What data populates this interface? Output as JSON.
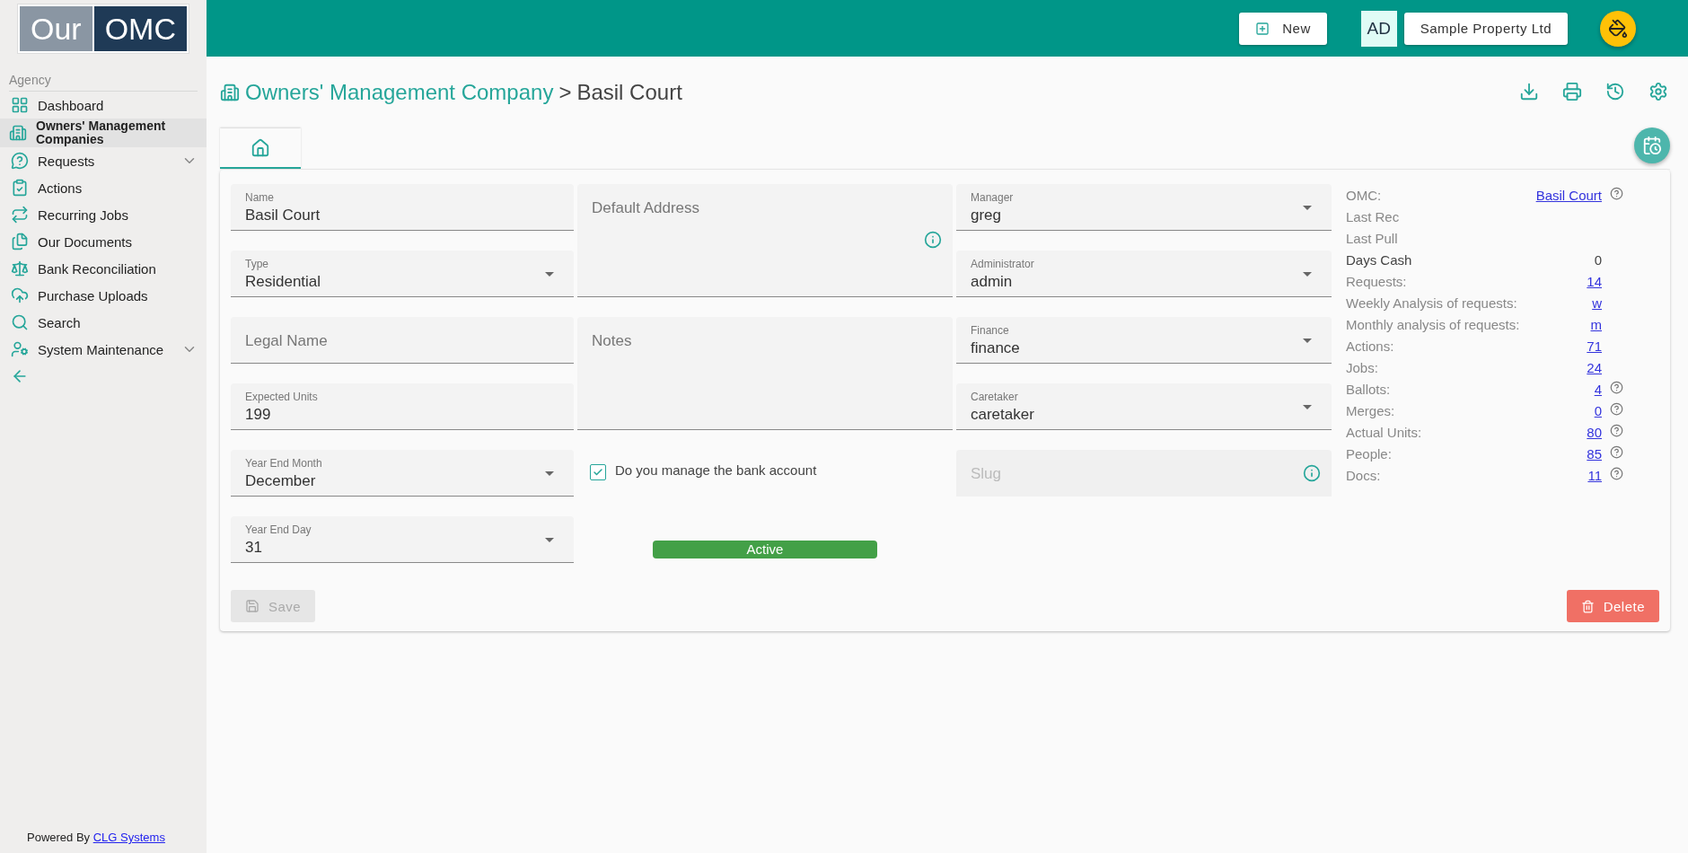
{
  "logo": {
    "part_1": "Our",
    "part_2": "OMC"
  },
  "sidebar": {
    "section": "Agency",
    "items": [
      {
        "label": "Dashboard",
        "selected": false,
        "has_submenu": false
      },
      {
        "label": "Owners' Management Companies",
        "selected": true,
        "has_submenu": false
      },
      {
        "label": "Requests",
        "selected": false,
        "has_submenu": true
      },
      {
        "label": "Actions",
        "selected": false,
        "has_submenu": false
      },
      {
        "label": "Recurring Jobs",
        "selected": false,
        "has_submenu": false
      },
      {
        "label": "Our Documents",
        "selected": false,
        "has_submenu": false
      },
      {
        "label": "Bank Reconciliation",
        "selected": false,
        "has_submenu": false
      },
      {
        "label": "Purchase Uploads",
        "selected": false,
        "has_submenu": false
      },
      {
        "label": "Search",
        "selected": false,
        "has_submenu": false
      },
      {
        "label": "System Maintenance",
        "selected": false,
        "has_submenu": true
      }
    ],
    "footer": {
      "text": "Powered By",
      "link": "CLG Systems"
    }
  },
  "topbar": {
    "new_button": "New",
    "avatar": "AD",
    "organization": "Sample Property Ltd"
  },
  "breadcrumb": {
    "parent": "Owners' Management Company",
    "separator": ">",
    "current": "Basil Court"
  },
  "tabs": [
    {
      "selected": true
    }
  ],
  "form": {
    "columns": [
      [
        {
          "kind": "text",
          "label": "Name",
          "value": "Basil Court"
        },
        {
          "kind": "select",
          "label": "Type",
          "value": "Residential"
        },
        {
          "kind": "text",
          "label": "Legal Name"
        },
        {
          "kind": "text",
          "label": "Expected Units",
          "value": "199"
        },
        {
          "kind": "select",
          "label": "Year End Month",
          "value": "December"
        },
        {
          "kind": "select",
          "label": "Year End Day",
          "value": "31"
        }
      ],
      [
        {
          "kind": "textarea",
          "label": "Default Address",
          "info": true
        },
        {
          "kind": "textarea",
          "label": "Notes",
          "info": false
        },
        {
          "kind": "checkbox",
          "label": "Do you manage the bank account",
          "checked": true
        },
        {
          "kind": "status",
          "label": "Active"
        }
      ],
      [
        {
          "kind": "select",
          "label": "Manager",
          "value": "greg"
        },
        {
          "kind": "select",
          "label": "Administrator",
          "value": "admin"
        },
        {
          "kind": "select",
          "label": "Finance",
          "value": "finance"
        },
        {
          "kind": "select",
          "label": "Caretaker",
          "value": "caretaker"
        },
        {
          "kind": "text",
          "label": "Slug",
          "disabled": true,
          "info": true
        }
      ]
    ]
  },
  "summary": [
    {
      "label": "OMC:",
      "value": "Basil Court",
      "link": true,
      "help": true
    },
    {
      "label": "Last Rec",
      "help": false
    },
    {
      "label": "Last Pull",
      "help": false
    },
    {
      "label": "Days Cash",
      "value": "0",
      "link": false,
      "help": false,
      "emphasis": true
    },
    {
      "label": "Requests:",
      "value": "14",
      "link": true,
      "help": false
    },
    {
      "label": "Weekly Analysis of requests:",
      "value": "w",
      "link": true,
      "help": false
    },
    {
      "label": "Monthly analysis of requests:",
      "value": "m",
      "link": true,
      "help": false
    },
    {
      "label": "Actions:",
      "value": "71",
      "link": true,
      "help": false
    },
    {
      "label": "Jobs:",
      "value": "24",
      "link": true,
      "help": false
    },
    {
      "label": "Ballots:",
      "value": "4",
      "link": true,
      "help": true
    },
    {
      "label": "Merges:",
      "value": "0",
      "link": true,
      "help": true
    },
    {
      "label": "Actual Units:",
      "value": "80",
      "link": true,
      "help": true
    },
    {
      "label": "People:",
      "value": "85",
      "link": true,
      "help": true
    },
    {
      "label": "Docs:",
      "value": "11",
      "link": true,
      "help": true
    }
  ],
  "actions": {
    "save": {
      "label": "Save",
      "disabled": true
    },
    "delete": {
      "label": "Delete"
    }
  }
}
